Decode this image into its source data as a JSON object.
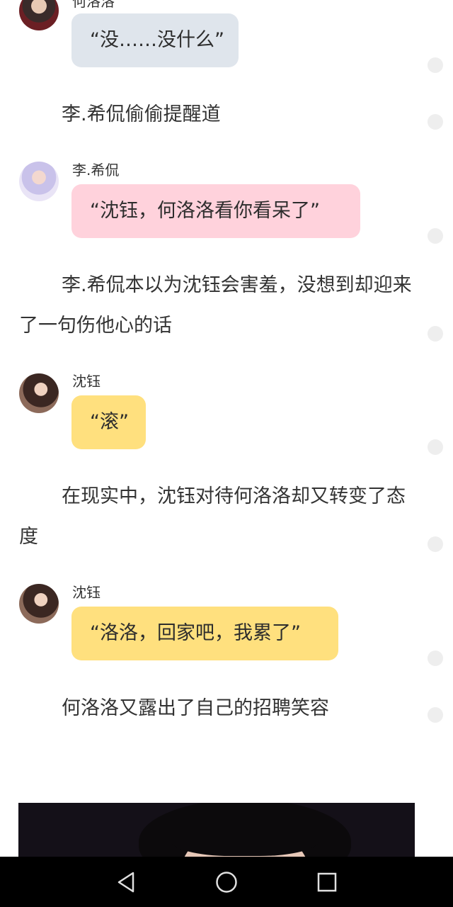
{
  "messages": [
    {
      "speaker": "何洛洛",
      "text": "“没……没什么”"
    },
    {
      "speaker": "李.希侃",
      "text": "“沈钰，何洛洛看你看呆了”"
    },
    {
      "speaker": "沈钰",
      "text": "“滚”"
    },
    {
      "speaker": "沈钰",
      "text": "“洛洛，回家吧，我累了”"
    }
  ],
  "narration": [
    "李.希侃偷偷提醒道",
    "李.希侃本以为沈钰会害羞，没想到却迎来了一句伤他心的话",
    "在现实中，沈钰对待何洛洛却又转变了态度",
    "何洛洛又露出了自己的招聘笑容"
  ],
  "navbar": {
    "back_icon": "triangle-back-icon",
    "home_icon": "circle-home-icon",
    "recents_icon": "square-recents-icon"
  },
  "colors": {
    "bubble_gray": "#dfe5ec",
    "bubble_pink": "#ffd2dc",
    "bubble_yellow": "#ffe07e"
  }
}
